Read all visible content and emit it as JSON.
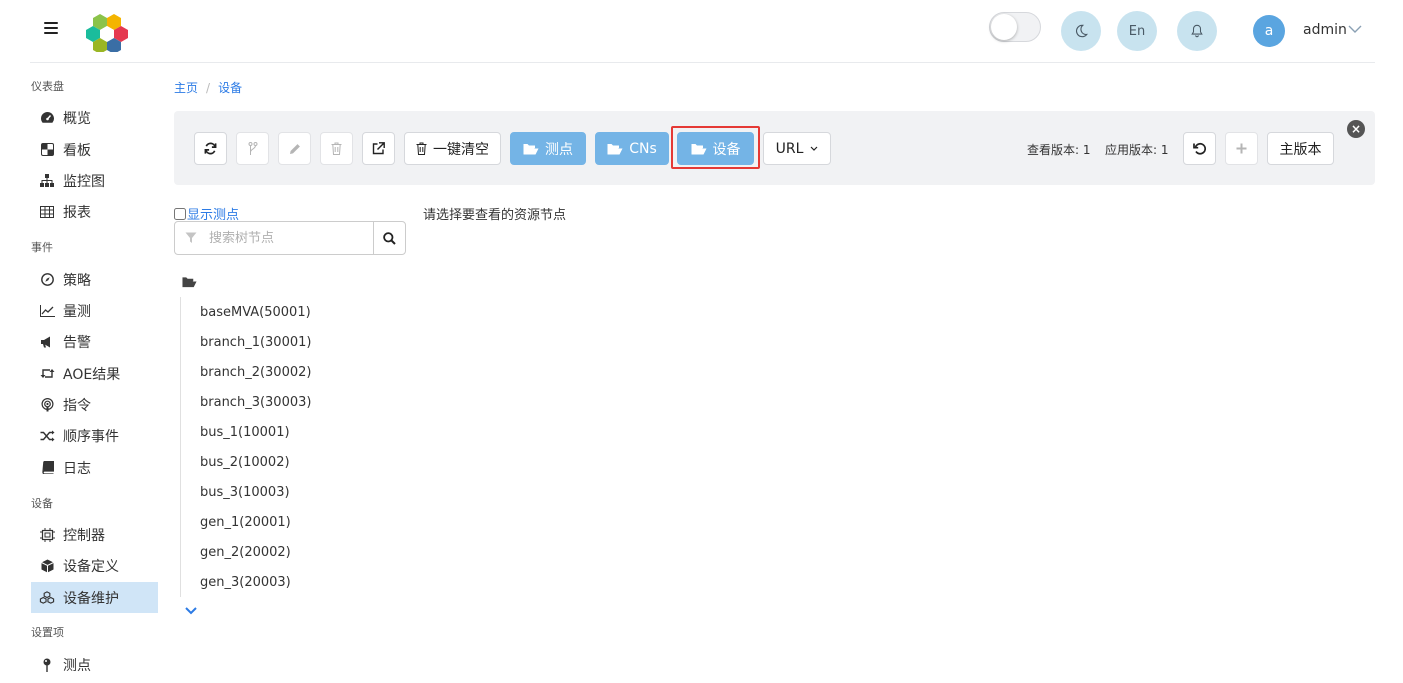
{
  "header": {
    "username": "admin",
    "avatar_letter": "a",
    "lang_label": "En",
    "theme_toggle": "off"
  },
  "sidebar": {
    "sections": [
      {
        "title": "仪表盘",
        "items": [
          {
            "label": "概览",
            "icon": "tachometer-icon"
          },
          {
            "label": "看板",
            "icon": "board-icon"
          },
          {
            "label": "监控图",
            "icon": "sitemap-icon"
          },
          {
            "label": "报表",
            "icon": "table-icon"
          }
        ]
      },
      {
        "title": "事件",
        "items": [
          {
            "label": "策略",
            "icon": "compass-icon"
          },
          {
            "label": "量测",
            "icon": "line-chart-icon"
          },
          {
            "label": "告警",
            "icon": "bullhorn-icon"
          },
          {
            "label": "AOE结果",
            "icon": "retweet-icon"
          },
          {
            "label": "指令",
            "icon": "podcast-icon"
          },
          {
            "label": "顺序事件",
            "icon": "random-icon"
          },
          {
            "label": "日志",
            "icon": "book-icon"
          }
        ]
      },
      {
        "title": "设备",
        "items": [
          {
            "label": "控制器",
            "icon": "controller-icon"
          },
          {
            "label": "设备定义",
            "icon": "cube-icon"
          },
          {
            "label": "设备维护",
            "icon": "cubes-icon",
            "active": true
          }
        ]
      },
      {
        "title": "设置项",
        "items": [
          {
            "label": "测点",
            "icon": "map-pin-icon"
          }
        ]
      }
    ]
  },
  "breadcrumb": {
    "home": "主页",
    "current": "设备"
  },
  "toolbar": {
    "clear_all": "一键清空",
    "points": "测点",
    "cns": "CNs",
    "devices": "设备",
    "url": "URL",
    "view_version": "查看版本: 1",
    "apply_version": "应用版本: 1",
    "main_version": "主版本"
  },
  "tree": {
    "show_points": "显示测点",
    "search_placeholder": "搜索树节点",
    "items": [
      "baseMVA(50001)",
      "branch_1(30001)",
      "branch_2(30002)",
      "branch_3(30003)",
      "bus_1(10001)",
      "bus_2(10002)",
      "bus_3(10003)",
      "gen_1(20001)",
      "gen_2(20002)",
      "gen_3(20003)"
    ]
  },
  "hint": "请选择要查看的资源节点",
  "colors": {
    "accent_blue": "#74b4e6",
    "link_blue": "#2c7be5",
    "highlight_red": "#e53935",
    "active_bg": "#d0e5f7"
  }
}
